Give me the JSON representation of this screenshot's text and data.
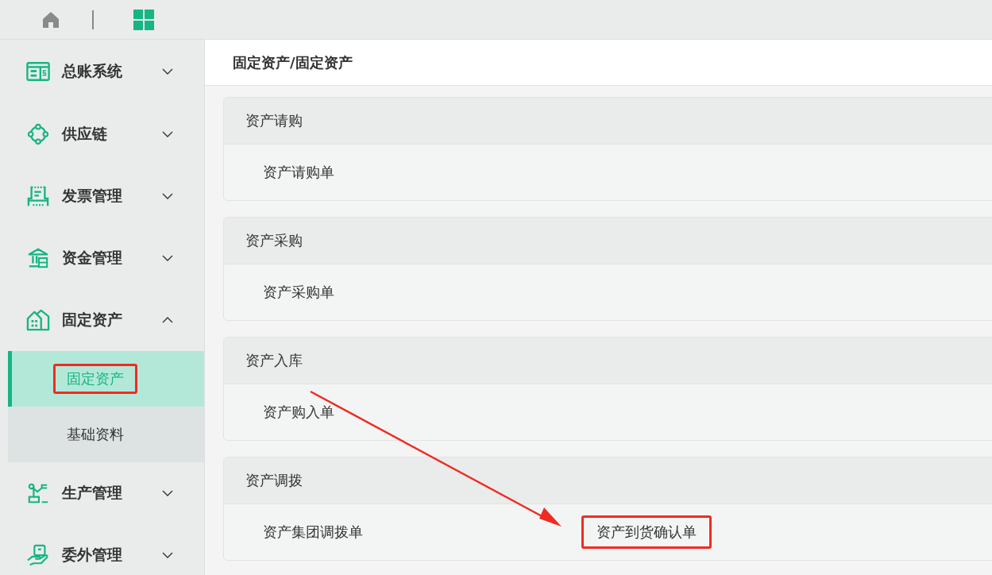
{
  "sidebar": {
    "items": [
      {
        "label": "总账系统",
        "expanded": false
      },
      {
        "label": "供应链",
        "expanded": false
      },
      {
        "label": "发票管理",
        "expanded": false
      },
      {
        "label": "资金管理",
        "expanded": false
      },
      {
        "label": "固定资产",
        "expanded": true,
        "children": [
          {
            "label": "固定资产",
            "selected": true,
            "highlighted": true
          },
          {
            "label": "基础资料",
            "selected": false,
            "highlighted": false
          }
        ]
      },
      {
        "label": "生产管理",
        "expanded": false
      },
      {
        "label": "委外管理",
        "expanded": false
      }
    ]
  },
  "breadcrumb": "固定资产/固定资产",
  "cards": [
    {
      "title": "资产请购",
      "items": [
        {
          "label": "资产请购单",
          "highlighted": false
        }
      ]
    },
    {
      "title": "资产采购",
      "items": [
        {
          "label": "资产采购单",
          "highlighted": false
        }
      ]
    },
    {
      "title": "资产入库",
      "items": [
        {
          "label": "资产购入单",
          "highlighted": false
        }
      ]
    },
    {
      "title": "资产调拨",
      "items": [
        {
          "label": "资产集团调拨单",
          "highlighted": false
        },
        {
          "label": "资产到货确认单",
          "highlighted": true
        }
      ]
    }
  ]
}
